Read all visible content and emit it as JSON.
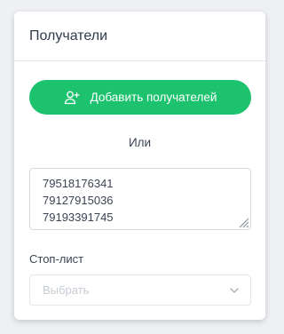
{
  "card": {
    "title": "Получатели"
  },
  "add_button": {
    "label": "Добавить получателей",
    "icon": "add-user-icon",
    "color": "#1dc26e"
  },
  "or_text": "Или",
  "phones": {
    "lines": [
      "79518176341",
      "79127915036",
      "79193391745"
    ]
  },
  "stop_list": {
    "label": "Стоп-лист",
    "placeholder": "Выбрать",
    "icon": "chevron-down-icon"
  }
}
